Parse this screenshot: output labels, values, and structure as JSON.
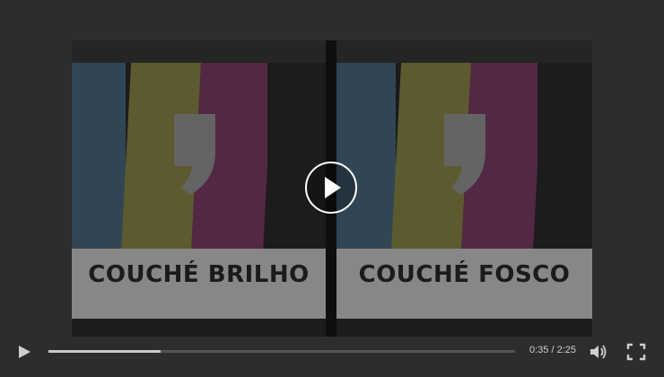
{
  "video": {
    "left_label": "COUCHÉ BRILHO",
    "right_label": "COUCHÉ FOSCO"
  },
  "colors": {
    "cyan": "#4e6a82",
    "yellow": "#8f8b4a",
    "magenta": "#7f3e69",
    "black": "#2a2a2a",
    "card": "#cfcfcf"
  },
  "controls": {
    "time_display": "0:35 / 2:25",
    "progress": 0.241,
    "play_icon": "play-icon",
    "volume_icon": "volume-icon",
    "fullscreen_icon": "fullscreen-icon"
  }
}
